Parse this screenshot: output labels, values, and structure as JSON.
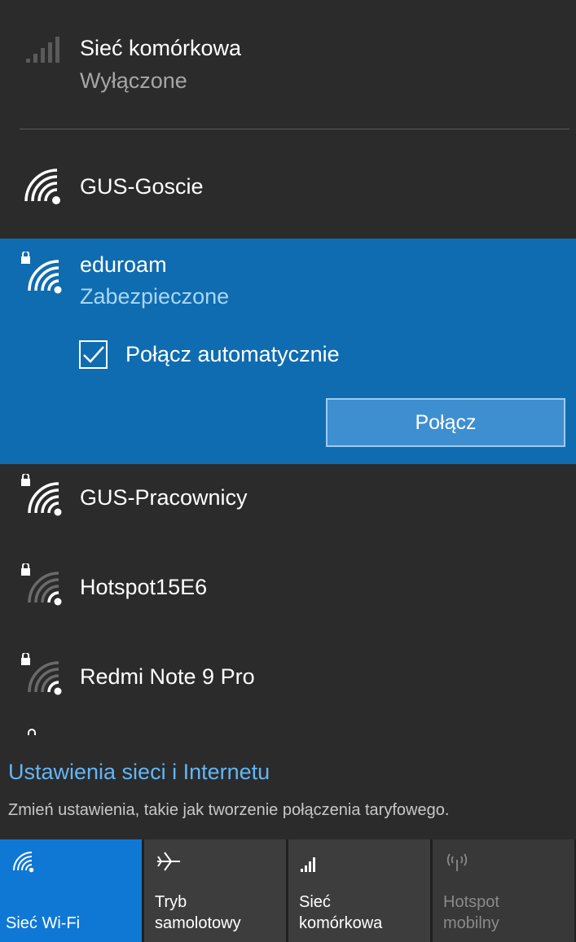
{
  "cellular": {
    "name": "Sieć komórkowa",
    "status": "Wyłączone",
    "icon": "cellular-signal-icon"
  },
  "networks": [
    {
      "name": "GUS-Goscie",
      "secured": false,
      "signal": "full",
      "icon": "wifi-icon"
    },
    {
      "name": "eduroam",
      "status": "Zabezpieczone",
      "secured": true,
      "signal": "full",
      "icon": "wifi-secure-icon",
      "selected": true
    },
    {
      "name": "GUS-Pracownicy",
      "secured": true,
      "signal": "full",
      "icon": "wifi-secure-icon"
    },
    {
      "name": "Hotspot15E6",
      "secured": true,
      "signal": "weak",
      "icon": "wifi-secure-icon"
    },
    {
      "name": "Redmi Note 9 Pro",
      "secured": true,
      "signal": "weak",
      "icon": "wifi-secure-icon"
    }
  ],
  "selected_network": {
    "auto_connect_label": "Połącz automatycznie",
    "auto_connect_checked": true,
    "connect_button": "Połącz"
  },
  "settings": {
    "title": "Ustawienia sieci i Internetu",
    "description": "Zmień ustawienia, takie jak tworzenie połączenia taryfowego."
  },
  "quick_actions": [
    {
      "label": "Sieć Wi-Fi",
      "icon": "wifi-icon",
      "active": true
    },
    {
      "label_line1": "Tryb",
      "label_line2": "samolotowy",
      "icon": "airplane-icon",
      "active": false
    },
    {
      "label_line1": "Sieć",
      "label_line2": "komórkowa",
      "icon": "cellular-signal-icon",
      "active": false
    },
    {
      "label_line1": "Hotspot",
      "label_line2": "mobilny",
      "icon": "hotspot-icon",
      "active": false,
      "disabled": true
    }
  ],
  "colors": {
    "background": "#2b2b2b",
    "accent": "#0f6cb0",
    "link": "#63b6f4",
    "tile_active": "#0f78d4"
  }
}
